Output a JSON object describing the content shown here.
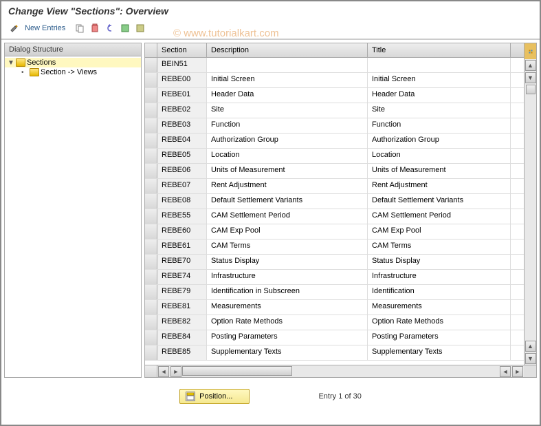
{
  "title": "Change View \"Sections\": Overview",
  "watermark": "© www.tutorialkart.com",
  "toolbar": {
    "new_entries": "New Entries"
  },
  "tree": {
    "header": "Dialog Structure",
    "items": [
      {
        "label": "Sections",
        "selected": true,
        "expanded": true
      },
      {
        "label": "Section -> Views",
        "child": true
      }
    ]
  },
  "table": {
    "headers": {
      "section": "Section",
      "description": "Description",
      "title": "Title"
    },
    "rows": [
      {
        "section": "BEIN51",
        "description": "",
        "title": ""
      },
      {
        "section": "REBE00",
        "description": "Initial Screen",
        "title": "Initial Screen"
      },
      {
        "section": "REBE01",
        "description": "Header Data",
        "title": "Header Data"
      },
      {
        "section": "REBE02",
        "description": "Site",
        "title": "Site"
      },
      {
        "section": "REBE03",
        "description": "Function",
        "title": "Function"
      },
      {
        "section": "REBE04",
        "description": "Authorization Group",
        "title": "Authorization Group"
      },
      {
        "section": "REBE05",
        "description": "Location",
        "title": "Location"
      },
      {
        "section": "REBE06",
        "description": "Units of Measurement",
        "title": "Units of Measurement"
      },
      {
        "section": "REBE07",
        "description": "Rent Adjustment",
        "title": "Rent Adjustment"
      },
      {
        "section": "REBE08",
        "description": "Default Settlement Variants",
        "title": "Default Settlement Variants"
      },
      {
        "section": "REBE55",
        "description": "CAM Settlement Period",
        "title": "CAM Settlement Period"
      },
      {
        "section": "REBE60",
        "description": "CAM Exp Pool",
        "title": "CAM Exp Pool"
      },
      {
        "section": "REBE61",
        "description": "CAM Terms",
        "title": "CAM Terms"
      },
      {
        "section": "REBE70",
        "description": "Status Display",
        "title": "Status Display"
      },
      {
        "section": "REBE74",
        "description": "Infrastructure",
        "title": "Infrastructure"
      },
      {
        "section": "REBE79",
        "description": "Identification in Subscreen",
        "title": "Identification"
      },
      {
        "section": "REBE81",
        "description": "Measurements",
        "title": "Measurements"
      },
      {
        "section": "REBE82",
        "description": "Option Rate Methods",
        "title": "Option Rate Methods"
      },
      {
        "section": "REBE84",
        "description": "Posting Parameters",
        "title": "Posting Parameters"
      },
      {
        "section": "REBE85",
        "description": "Supplementary Texts",
        "title": "Supplementary Texts"
      }
    ]
  },
  "footer": {
    "position_btn": "Position...",
    "entry_text": "Entry 1 of 30"
  }
}
